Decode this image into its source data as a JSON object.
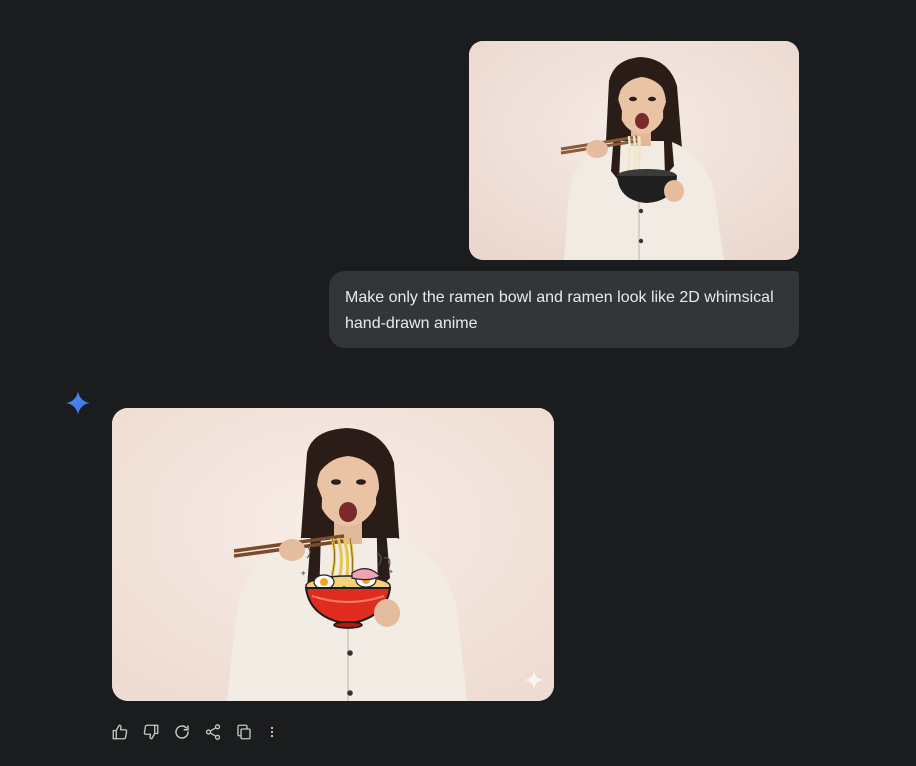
{
  "conversation": {
    "user_message": {
      "image_icon": "uploaded-photo",
      "text": "Make only the ramen bowl and ramen look like 2D whimsical hand-drawn anime"
    },
    "model_response": {
      "avatar_icon": "gemini-spark-icon",
      "image_icon": "generated-image",
      "watermark_icon": "sparkle-watermark-icon"
    }
  },
  "actions": [
    {
      "name": "thumbs-up-icon"
    },
    {
      "name": "thumbs-down-icon"
    },
    {
      "name": "regenerate-icon"
    },
    {
      "name": "share-icon"
    },
    {
      "name": "copy-icon"
    },
    {
      "name": "more-options-icon"
    }
  ],
  "colors": {
    "background": "#1b1c1e",
    "bubble": "#333537",
    "text": "#e8eaed",
    "icon": "#c4c7c5",
    "gemini_blue": "#4285f4"
  }
}
